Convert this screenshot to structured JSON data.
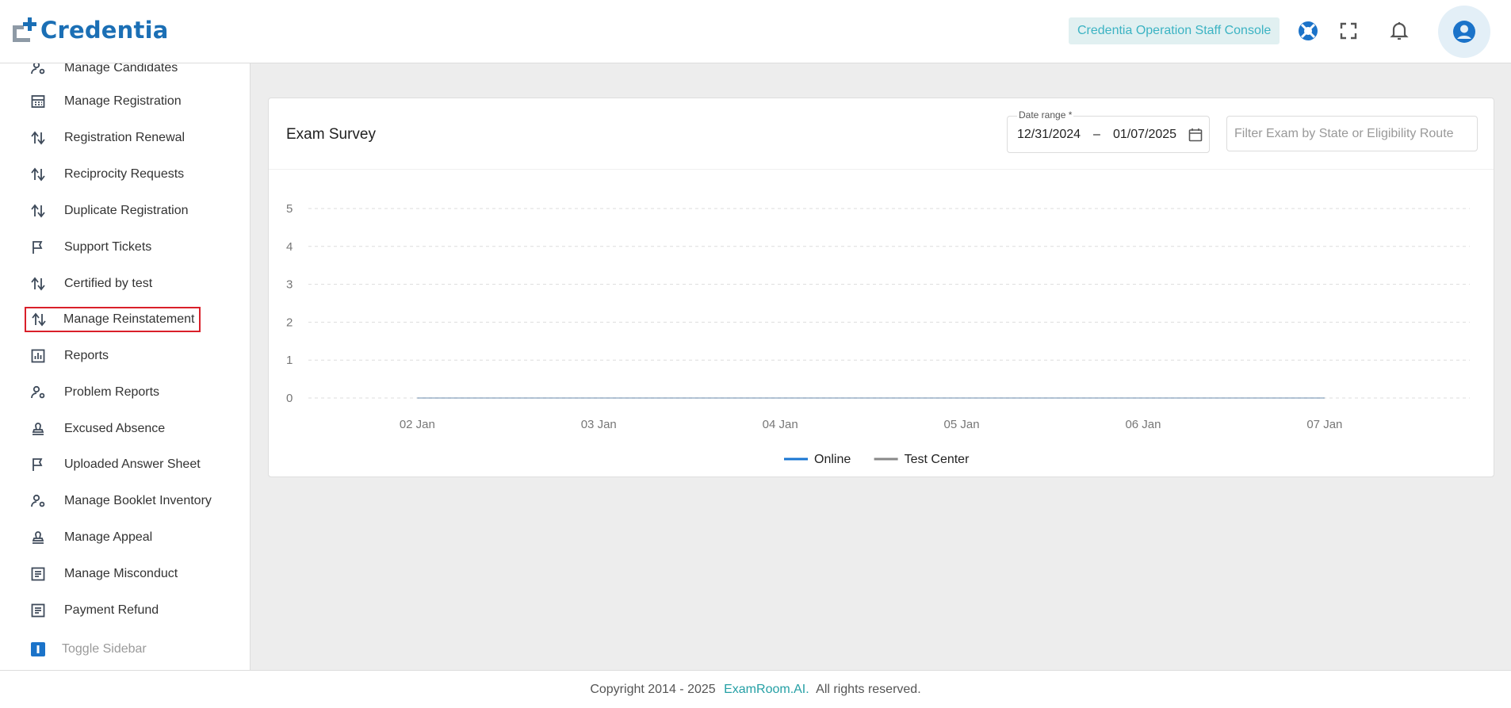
{
  "header": {
    "brand": "Credentia",
    "console_label": "Credentia Operation Staff Console",
    "icons": [
      "support-icon",
      "fullscreen-icon",
      "bell-icon",
      "account-icon"
    ],
    "colors": {
      "brand": "#1b6fb5",
      "accent": "#3bb3c3"
    }
  },
  "sidebar": {
    "items": [
      {
        "label": "Manage Candidates",
        "icon": "user-gear-icon"
      },
      {
        "label": "Manage Registration",
        "icon": "calendar-grid-icon"
      },
      {
        "label": "Registration Renewal",
        "icon": "swap-arrows-icon"
      },
      {
        "label": "Reciprocity Requests",
        "icon": "swap-arrows-icon"
      },
      {
        "label": "Duplicate Registration",
        "icon": "swap-arrows-icon"
      },
      {
        "label": "Support Tickets",
        "icon": "flag-icon"
      },
      {
        "label": "Certified by test",
        "icon": "swap-arrows-icon"
      },
      {
        "label": "Manage Reinstatement",
        "icon": "swap-arrows-icon"
      },
      {
        "label": "Reports",
        "icon": "bar-chart-icon"
      },
      {
        "label": "Problem Reports",
        "icon": "user-gear-icon"
      },
      {
        "label": "Excused Absence",
        "icon": "stamp-icon"
      },
      {
        "label": "Uploaded Answer Sheet",
        "icon": "flag-icon"
      },
      {
        "label": "Manage Booklet Inventory",
        "icon": "user-gear-icon"
      },
      {
        "label": "Manage Appeal",
        "icon": "stamp-icon"
      },
      {
        "label": "Manage Misconduct",
        "icon": "document-icon"
      },
      {
        "label": "Payment Refund",
        "icon": "document-icon"
      }
    ],
    "toggle_label": "Toggle Sidebar",
    "selected_index": 7
  },
  "main": {
    "card_title": "Exam Survey",
    "date_range": {
      "label": "Date range *",
      "start": "12/31/2024",
      "separator": "–",
      "end": "01/07/2025"
    },
    "filter_placeholder": "Filter Exam by State or Eligibility Route"
  },
  "chart_data": {
    "type": "line",
    "categories": [
      "02 Jan",
      "03 Jan",
      "04 Jan",
      "05 Jan",
      "06 Jan",
      "07 Jan"
    ],
    "series": [
      {
        "name": "Online",
        "values": [
          0,
          0,
          0,
          0,
          0,
          0
        ],
        "color": "#1976d2"
      },
      {
        "name": "Test Center",
        "values": [
          0,
          0,
          0,
          0,
          0,
          0
        ],
        "color": "#888888"
      }
    ],
    "y_ticks": [
      "0",
      "1",
      "2",
      "3",
      "4",
      "5"
    ],
    "ylim": [
      0,
      5
    ],
    "grid": true,
    "legend": "bottom-center"
  },
  "footer": {
    "prefix": "Copyright 2014 - 2025",
    "link": "ExamRoom.AI.",
    "suffix": "All rights reserved."
  }
}
